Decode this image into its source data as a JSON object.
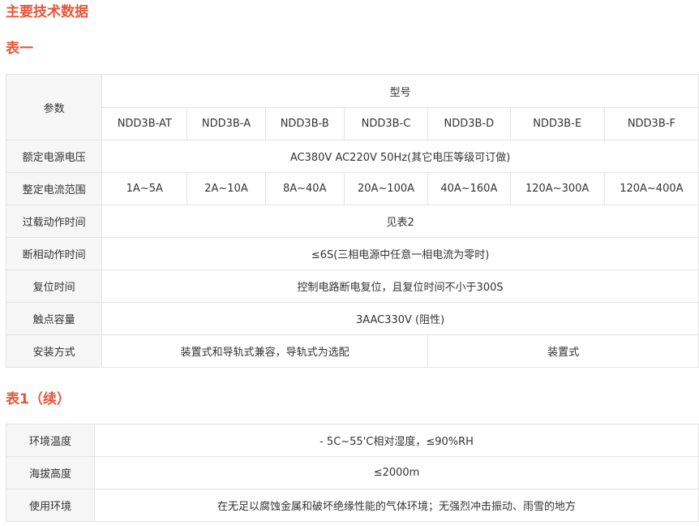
{
  "headings": {
    "main": "主要技术数据",
    "table1": "表一",
    "table1_cont": "表1（续）"
  },
  "table1": {
    "param_header": "参数",
    "model_header": "型号",
    "models": [
      "NDD3B-AT",
      "NDD3B-A",
      "NDD3B-B",
      "NDD3B-C",
      "NDD3B-D",
      "NDD3B-E",
      "NDD3B-F"
    ],
    "rows": {
      "rated_voltage": {
        "label": "额定电源电压",
        "value": "AC380V AC220V 50Hz(其它电压等级可订做)"
      },
      "current_range": {
        "label": "整定电流范围",
        "values": [
          "1A~5A",
          "2A~10A",
          "8A~40A",
          "20A~100A",
          "40A~160A",
          "120A~300A",
          "120A~400A"
        ]
      },
      "overload_time": {
        "label": "过载动作时间",
        "value": "见表2"
      },
      "phase_loss_time": {
        "label": "断相动作时间",
        "value": "≤6S(三相电源中任意一相电流为零时)"
      },
      "reset_time": {
        "label": "复位时间",
        "value": "控制电路断电复位，且复位时间不小于300S"
      },
      "contact_capacity": {
        "label": "触点容量",
        "value": "3AAC330V (阻性)"
      },
      "mounting": {
        "label": "安装方式",
        "value_left": "装置式和导轨式兼容，导轨式为选配",
        "value_right": "装置式"
      }
    }
  },
  "table1_cont": {
    "rows": {
      "env_temp": {
        "label": "环境温度",
        "value": "- 5C~55'C相对湿度，≤90%RH"
      },
      "altitude": {
        "label": "海拔高度",
        "value": "≤2000m"
      },
      "environment": {
        "label": "使用环境",
        "value": "在无足以腐蚀金属和破坏绝缘性能的气体环境；无强烈冲击振动、雨雪的地方"
      }
    }
  }
}
